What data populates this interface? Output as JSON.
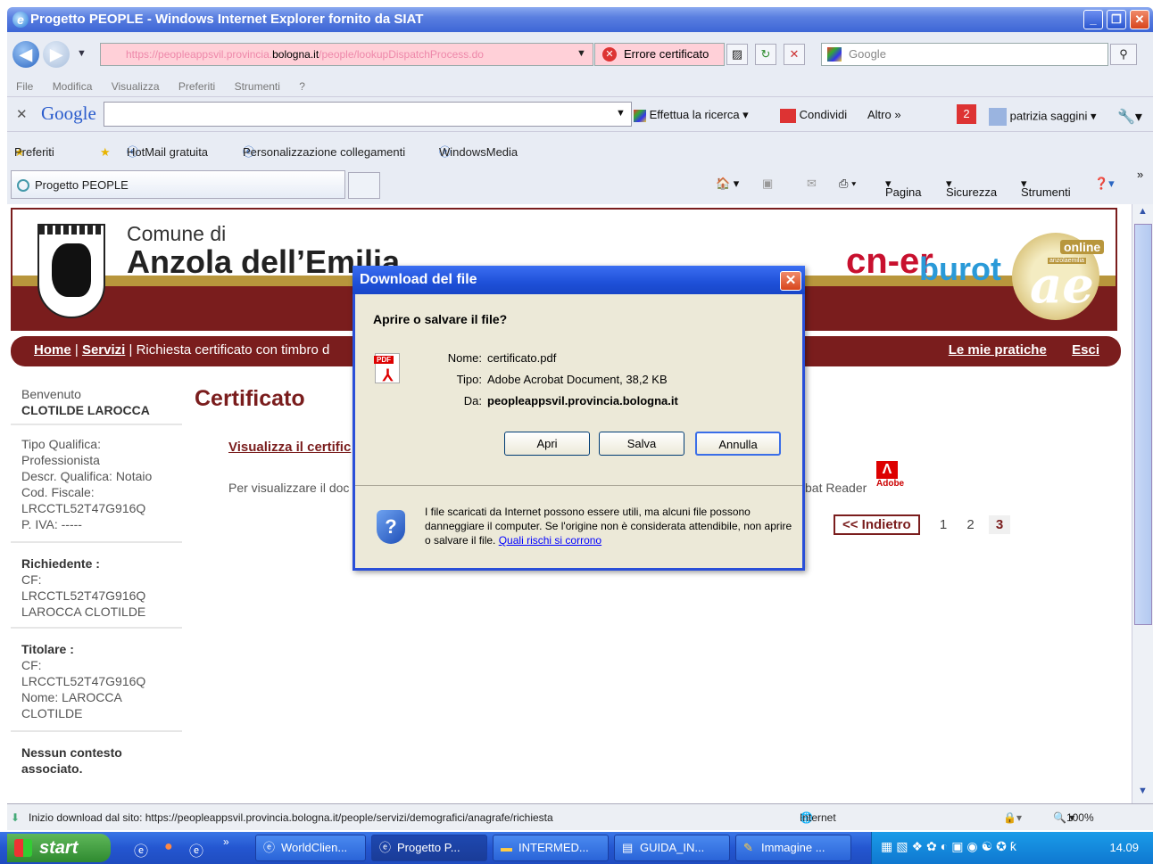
{
  "window": {
    "title": "Progetto PEOPLE - Windows Internet Explorer fornito da SIAT"
  },
  "address": {
    "prefix": "https://peopleappsvil.provincia.",
    "domain": "bologna.it",
    "suffix": "/people/lookupDispatchProcess.do",
    "cert_error": "Errore certificato",
    "search_placeholder": "Google"
  },
  "menu": [
    "File",
    "Modifica",
    "Visualizza",
    "Preferiti",
    "Strumenti",
    "?"
  ],
  "google_bar": {
    "logo": "Google",
    "search": "Effettua la ricerca",
    "share": "Condividi",
    "more": "Altro",
    "badge": "2",
    "user": "patrizia saggini"
  },
  "favorites": {
    "label": "Preferiti",
    "links": [
      "HotMail gratuita",
      "Personalizzazione collegamenti",
      "WindowsMedia"
    ]
  },
  "tab": {
    "title": "Progetto PEOPLE"
  },
  "commands": {
    "page": "Pagina",
    "security": "Sicurezza",
    "tools": "Strumenti"
  },
  "site": {
    "comune_line1": "Comune di",
    "comune_line2": "Anzola dell’Emilia",
    "logo_cn": "cn-er",
    "logo_buro": "burot",
    "online_label": "online",
    "online_sub": "anzolaemilia",
    "online_mark": "ae",
    "nav": {
      "home": "Home",
      "servizi": "Servizi",
      "crumb": "Richiesta certificato con timbro d",
      "pratiche": "Le mie pratiche",
      "esci": "Esci"
    },
    "sidebar": {
      "welcome": "Benvenuto",
      "user": "CLOTILDE LAROCCA",
      "qualifica": [
        "Tipo Qualifica:",
        "Professionista",
        "Descr. Qualifica: Notaio",
        "Cod. Fiscale:",
        "LRCCTL52T47G916Q",
        "P. IVA: -----"
      ],
      "richiedente_title": "Richiedente :",
      "richiedente": [
        "CF:",
        "LRCCTL52T47G916Q",
        "LAROCCA CLOTILDE"
      ],
      "titolare_title": "Titolare :",
      "titolare": [
        "CF:",
        "LRCCTL52T47G916Q",
        "Nome: LAROCCA",
        "CLOTILDE"
      ],
      "contesto": "Nessun contesto associato."
    },
    "main": {
      "title": "Certificato",
      "link": "Visualizza il certific",
      "info_left": "Per visualizzare il doc",
      "info_right": "bat Reader",
      "adobe": "Adobe",
      "back": "<< Indietro",
      "pages": [
        "1",
        "2",
        "3"
      ]
    }
  },
  "dialog": {
    "title": "Download del file",
    "question": "Aprire o salvare il file?",
    "name_label": "Nome:",
    "name": "certificato.pdf",
    "type_label": "Tipo:",
    "type": "Adobe Acrobat Document, 38,2 KB",
    "from_label": "Da:",
    "from": "peopleappsvil.provincia.bologna.it",
    "open": "Apri",
    "save": "Salva",
    "cancel": "Annulla",
    "warning": "I file scaricati da Internet possono essere utili, ma alcuni file possono danneggiare il computer. Se l'origine non è considerata attendibile, non aprire o salvare il file.",
    "risk_link": "Quali rischi si corrono"
  },
  "statusbar": {
    "text": "Inizio download dal sito: https://peopleappsvil.provincia.bologna.it/people/servizi/demografici/anagrafe/richiesta",
    "zone": "Internet",
    "zoom": "100%"
  },
  "taskbar": {
    "start": "start",
    "tasks": [
      "WorldClien...",
      "Progetto P...",
      "INTERMED...",
      "GUIDA_IN...",
      "Immagine ..."
    ],
    "clock": "14.09"
  }
}
